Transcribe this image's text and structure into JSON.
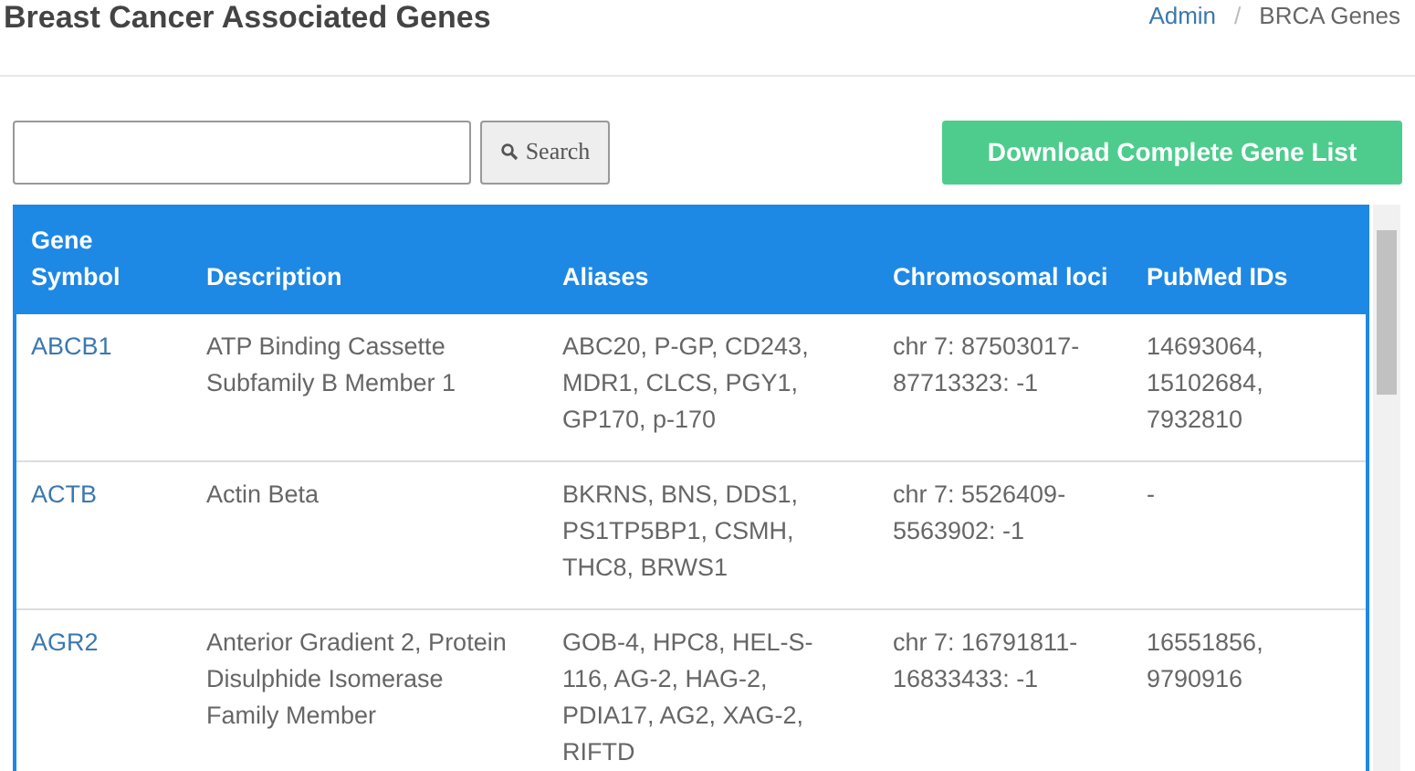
{
  "page_title": "Breast Cancer Associated Genes",
  "breadcrumb": {
    "separator": "/",
    "items": [
      {
        "label": "Admin",
        "current": false
      },
      {
        "label": "BRCA Genes",
        "current": true
      }
    ]
  },
  "search": {
    "button": "Search"
  },
  "download_button": "Download Complete Gene List",
  "table": {
    "columns": [
      "Gene Symbol",
      "Description",
      "Aliases",
      "Chromosomal loci",
      "PubMed IDs"
    ],
    "rows": [
      {
        "symbol": "ABCB1",
        "description": "ATP Binding Cassette Subfamily B Member 1",
        "aliases": "ABC20, P-GP, CD243, MDR1, CLCS, PGY1, GP170, p-170",
        "loci": "chr 7: 87503017-87713323: -1",
        "pubmed": "14693064, 15102684, 7932810"
      },
      {
        "symbol": "ACTB",
        "description": "Actin Beta",
        "aliases": "BKRNS, BNS, DDS1, PS1TP5BP1, CSMH, THC8, BRWS1",
        "loci": "chr 7: 5526409-5563902: -1",
        "pubmed": "-"
      },
      {
        "symbol": "AGR2",
        "description": "Anterior Gradient 2, Protein Disulphide Isomerase Family Member",
        "aliases": "GOB-4, HPC8, HEL-S-116, AG-2, HAG-2, PDIA17, AG2, XAG-2, RIFTD",
        "loci": "chr 7: 16791811-16833433: -1",
        "pubmed": "16551856, 9790916"
      }
    ]
  }
}
